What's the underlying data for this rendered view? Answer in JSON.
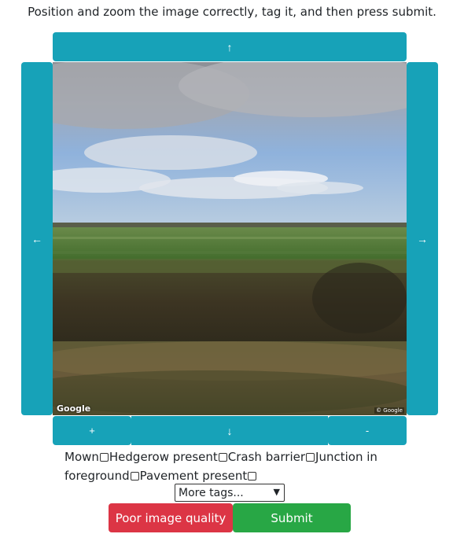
{
  "instructions": "Position and zoom the image correctly, tag it, and then press submit.",
  "nav": {
    "up": "↑",
    "down": "↓",
    "left": "←",
    "right": "→",
    "zoom_in": "+",
    "zoom_out": "-"
  },
  "street_view": {
    "logo": "Google",
    "copyright": "© Google"
  },
  "tags": [
    {
      "label": "Mown",
      "checked": false
    },
    {
      "label": "Hedgerow present",
      "checked": false
    },
    {
      "label": "Crash barrier",
      "checked": false
    },
    {
      "label": "Junction in foreground",
      "checked": false
    },
    {
      "label": "Pavement present",
      "checked": false
    }
  ],
  "more_tags": {
    "selected": "More tags..."
  },
  "actions": {
    "poor_quality": "Poor image quality",
    "submit": "Submit"
  },
  "colors": {
    "nav": "#17a2b8",
    "poor_quality": "#dc3545",
    "submit": "#28a745"
  },
  "icons": {
    "dropdown": "chevron-down-icon"
  }
}
